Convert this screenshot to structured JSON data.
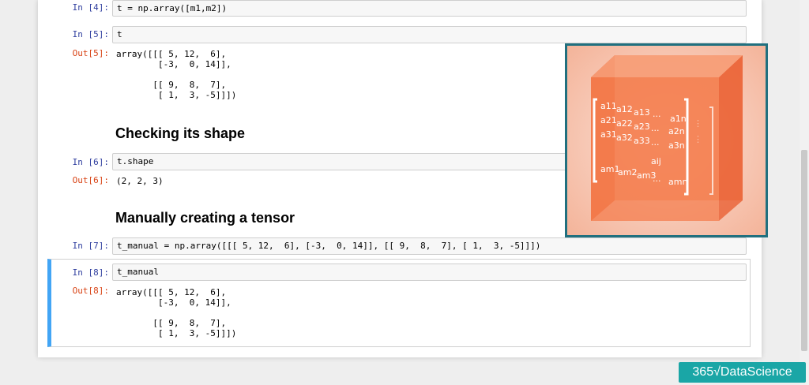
{
  "cells": [
    {
      "prompt": "In [4]:",
      "code": "t = np.array([m1,m2])"
    },
    {
      "prompt": "In [5]:",
      "code": "t",
      "out_prompt": "Out[5]:",
      "output": "array([[[ 5, 12,  6],\n        [-3,  0, 14]],\n\n       [[ 9,  8,  7],\n        [ 1,  3, -5]]])"
    },
    {
      "prompt": "In [6]:",
      "code": "t.shape",
      "out_prompt": "Out[6]:",
      "output": "(2, 2, 3)"
    },
    {
      "prompt": "In [7]:",
      "code": "t_manual = np.array([[[ 5, 12,  6], [-3,  0, 14]], [[ 9,  8,  7], [ 1,  3, -5]]])"
    },
    {
      "prompt": "In [8]:",
      "code": "t_manual",
      "out_prompt": "Out[8]:",
      "output": "array([[[ 5, 12,  6],\n        [-3,  0, 14]],\n\n       [[ 9,  8,  7],\n        [ 1,  3, -5]]])"
    }
  ],
  "headings": {
    "checking_shape": "Checking its shape",
    "manual_tensor": "Manually creating a tensor"
  },
  "illustration": {
    "matrix_labels": [
      "a11",
      "a12",
      "a13",
      "...",
      "a1n",
      "a21",
      "a22",
      "a23",
      "...",
      "a2n",
      "a31",
      "a32",
      "a33",
      "...",
      "a3n",
      "am1",
      "am2",
      "am3",
      "...",
      "aij",
      "amn"
    ],
    "icon": "tensor-cube-icon"
  },
  "logo": {
    "text": "365√DataScience"
  },
  "colors": {
    "in_prompt": "#303f9f",
    "out_prompt": "#d84315",
    "selected_border": "#42a5f5",
    "illustration_frame": "#20707f",
    "cube": "#f47a4a",
    "logo_bg": "#1aa6a6"
  }
}
